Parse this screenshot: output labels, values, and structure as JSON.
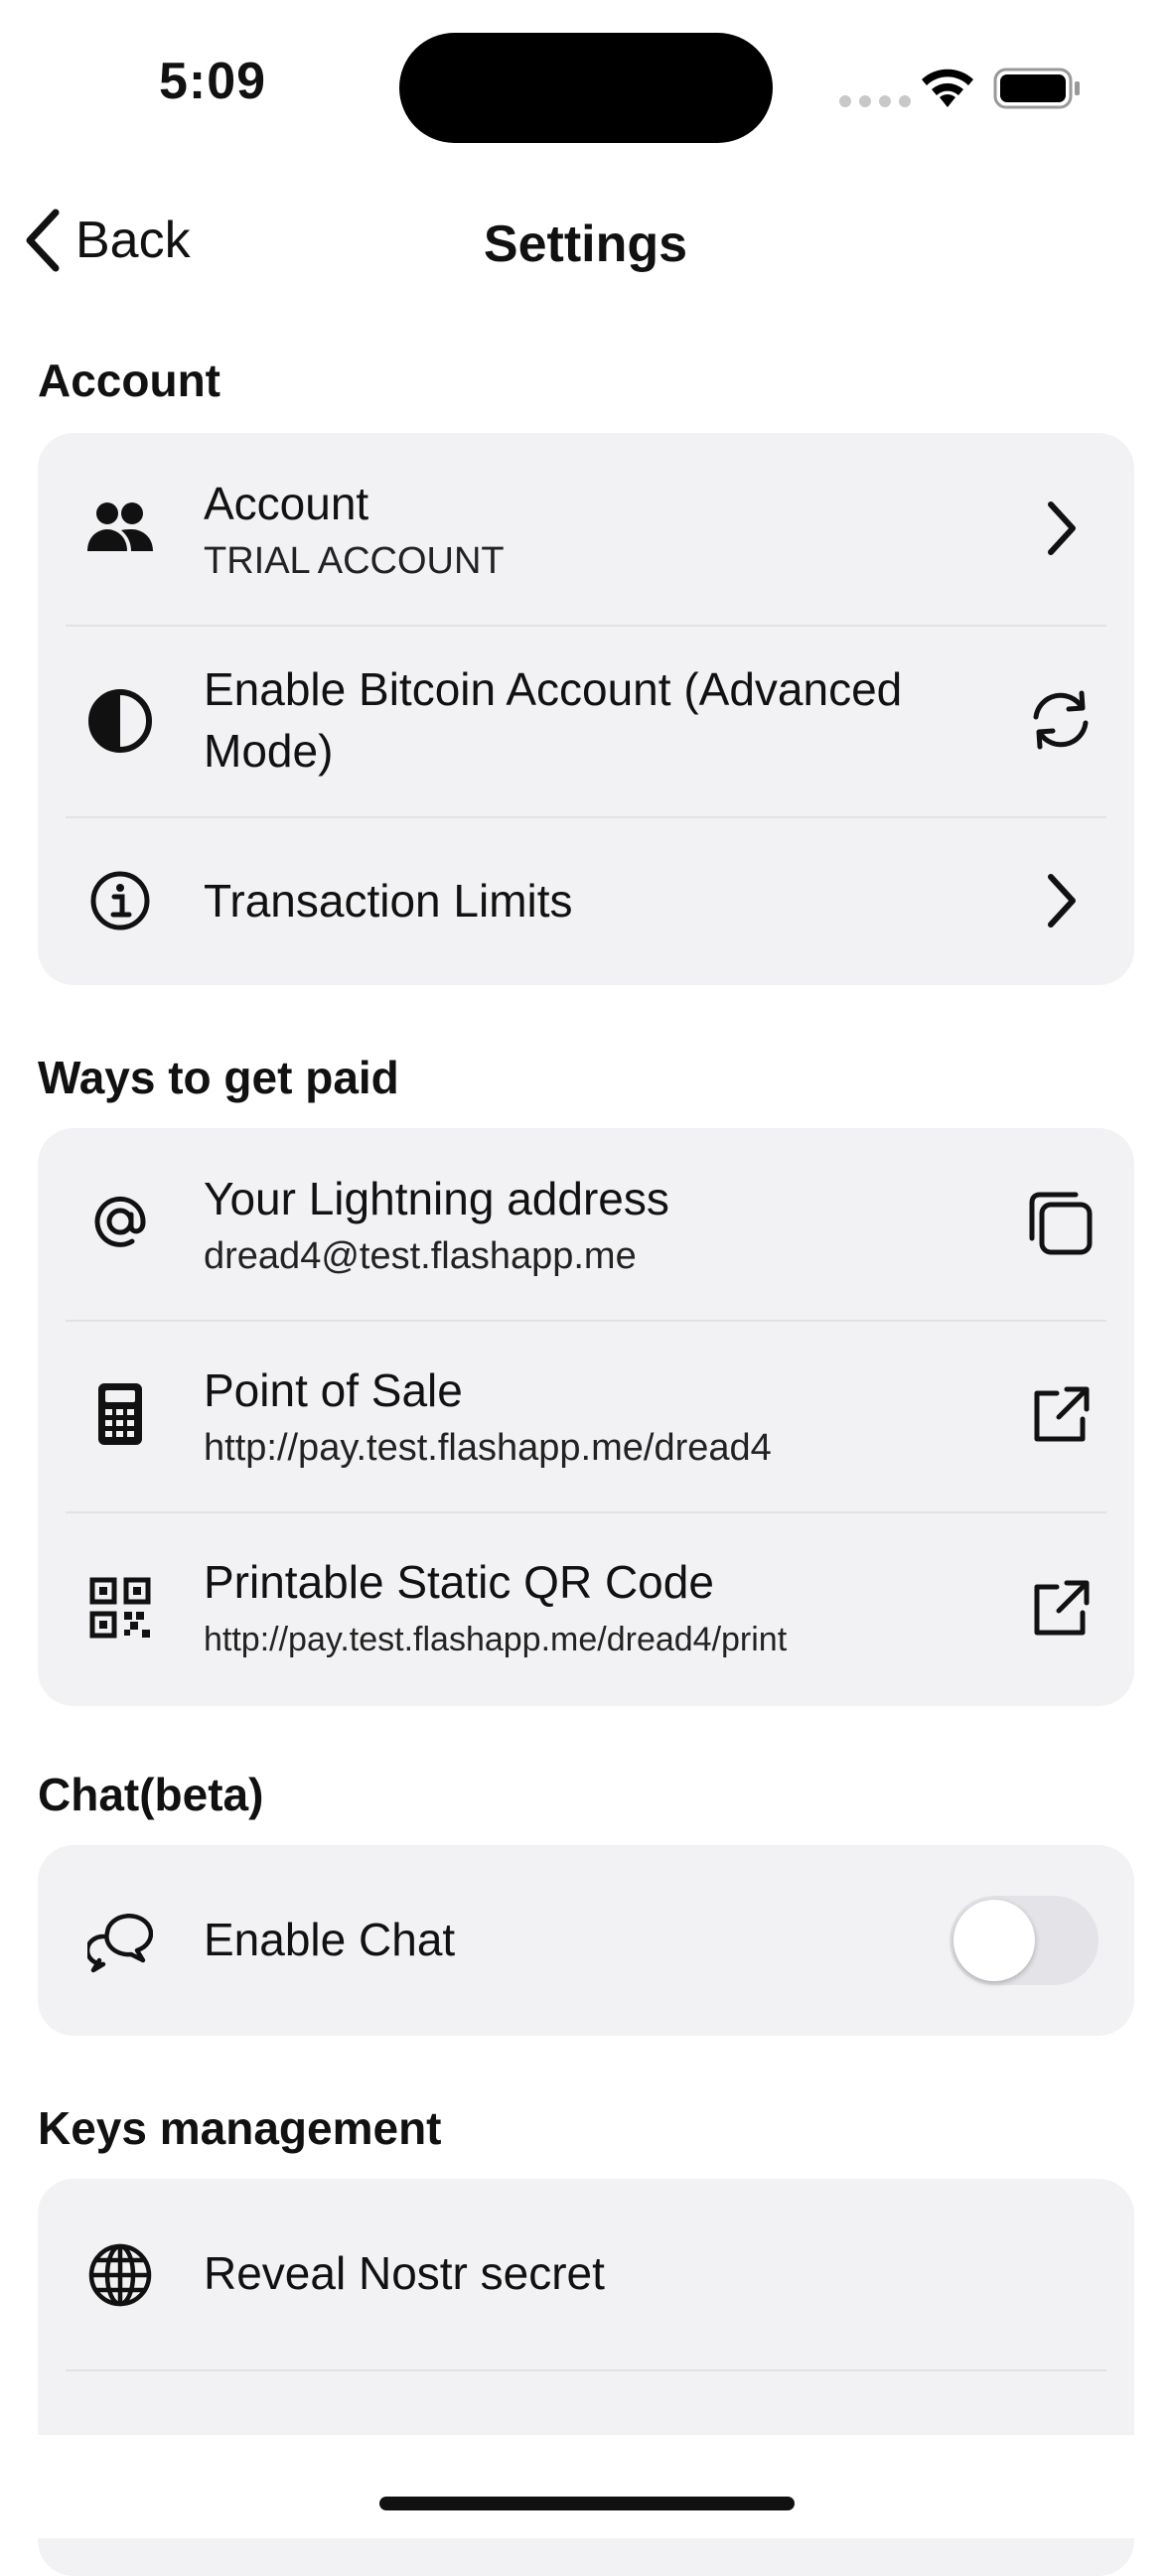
{
  "status_bar": {
    "time": "5:09"
  },
  "nav": {
    "back_label": "Back",
    "title": "Settings"
  },
  "sections": {
    "account": {
      "title": "Account",
      "rows": [
        {
          "icon": "users-icon",
          "title": "Account",
          "subtitle": "TRIAL ACCOUNT",
          "action": "chevron-right-icon"
        },
        {
          "icon": "half-circle-icon",
          "title": "Enable Bitcoin Account (Advanced Mode)",
          "action": "refresh-icon"
        },
        {
          "icon": "info-icon",
          "title": "Transaction Limits",
          "action": "chevron-right-icon"
        }
      ]
    },
    "ways_to_get_paid": {
      "title": "Ways to get paid",
      "rows": [
        {
          "icon": "at-icon",
          "title": "Your Lightning address",
          "subtitle": "dread4@test.flashapp.me",
          "action": "copy-icon"
        },
        {
          "icon": "calculator-icon",
          "title": "Point of Sale",
          "subtitle": "http://pay.test.flashapp.me/dread4",
          "action": "external-link-icon"
        },
        {
          "icon": "qr-code-icon",
          "title": "Printable Static QR Code",
          "subtitle": "http://pay.test.flashapp.me/dread4/print",
          "action": "external-link-icon"
        }
      ]
    },
    "chat": {
      "title": "Chat(beta)",
      "rows": [
        {
          "icon": "chat-bubbles-icon",
          "title": "Enable Chat",
          "toggle": false
        }
      ]
    },
    "keys": {
      "title": "Keys management",
      "rows": [
        {
          "icon": "globe-icon",
          "title": "Reveal Nostr secret"
        }
      ]
    }
  }
}
